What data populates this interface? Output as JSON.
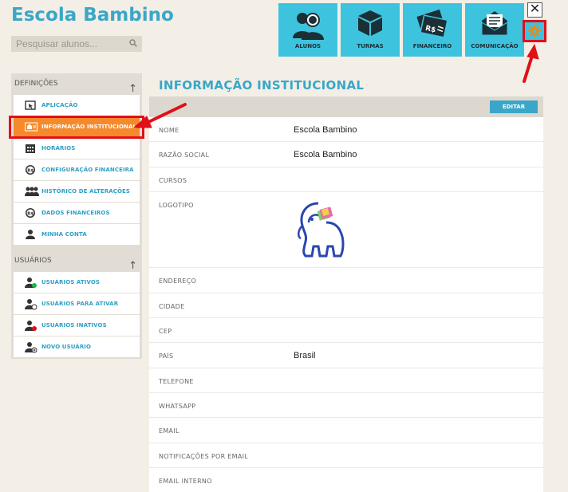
{
  "app": {
    "title": "Escola Bambino"
  },
  "search": {
    "placeholder": "Pesquisar alunos...",
    "icon": "search-icon"
  },
  "topnav": [
    {
      "label": "ALUNOS",
      "icon": "students-icon"
    },
    {
      "label": "TURMAS",
      "icon": "box-icon"
    },
    {
      "label": "FINANCEIRO",
      "icon": "money-icon"
    },
    {
      "label": "COMUNICAÇÃO",
      "icon": "envelope-icon"
    }
  ],
  "colors": {
    "accent": "#3ec3de",
    "title": "#3aa6c9",
    "active": "#f58a2c",
    "highlight": "#e0101a"
  },
  "sidebar": {
    "sections": [
      {
        "title": "DEFINIÇÕES",
        "items": [
          {
            "label": "APLICAÇÃO",
            "icon": "cursor-icon"
          },
          {
            "label": "INFORMAÇÃO INSTITUCIONAL",
            "icon": "institution-icon",
            "active": true
          },
          {
            "label": "HORÁRIOS",
            "icon": "calendar-icon"
          },
          {
            "label": "CONFIGURAÇÃO FINANCEIRA",
            "icon": "currency-icon"
          },
          {
            "label": "HISTÓRICO DE ALTERAÇÕES",
            "icon": "people-icon"
          },
          {
            "label": "DADOS FINANCEIROS",
            "icon": "currency-icon"
          },
          {
            "label": "MINHA CONTA",
            "icon": "user-icon"
          }
        ]
      },
      {
        "title": "USUÁRIOS",
        "items": [
          {
            "label": "USUÁRIOS ATIVOS",
            "icon": "user-active-icon"
          },
          {
            "label": "USUÁRIOS PARA ATIVAR",
            "icon": "user-pending-icon"
          },
          {
            "label": "USUÁRIOS INATIVOS",
            "icon": "user-inactive-icon"
          },
          {
            "label": "NOVO USUÁRIO",
            "icon": "user-add-icon"
          }
        ]
      }
    ]
  },
  "main": {
    "title": "INFORMAÇÃO INSTITUCIONAL",
    "edit_label": "EDITAR",
    "fields": [
      {
        "key": "NOME",
        "value": "Escola Bambino"
      },
      {
        "key": "RAZÃO SOCIAL",
        "value": "Escola Bambino"
      },
      {
        "key": "CURSOS",
        "value": ""
      },
      {
        "key": "LOGOTIPO",
        "value": "",
        "logo": "elephant-logo"
      },
      {
        "key": "ENDEREÇO",
        "value": ""
      },
      {
        "key": "CIDADE",
        "value": ""
      },
      {
        "key": "CEP",
        "value": ""
      },
      {
        "key": "PAÍS",
        "value": "Brasil"
      },
      {
        "key": "TELEFONE",
        "value": ""
      },
      {
        "key": "WHATSAPP",
        "value": ""
      },
      {
        "key": "EMAIL",
        "value": ""
      },
      {
        "key": "NOTIFICAÇÕES POR EMAIL",
        "value": ""
      },
      {
        "key": "EMAIL INTERNO",
        "value": ""
      }
    ]
  }
}
